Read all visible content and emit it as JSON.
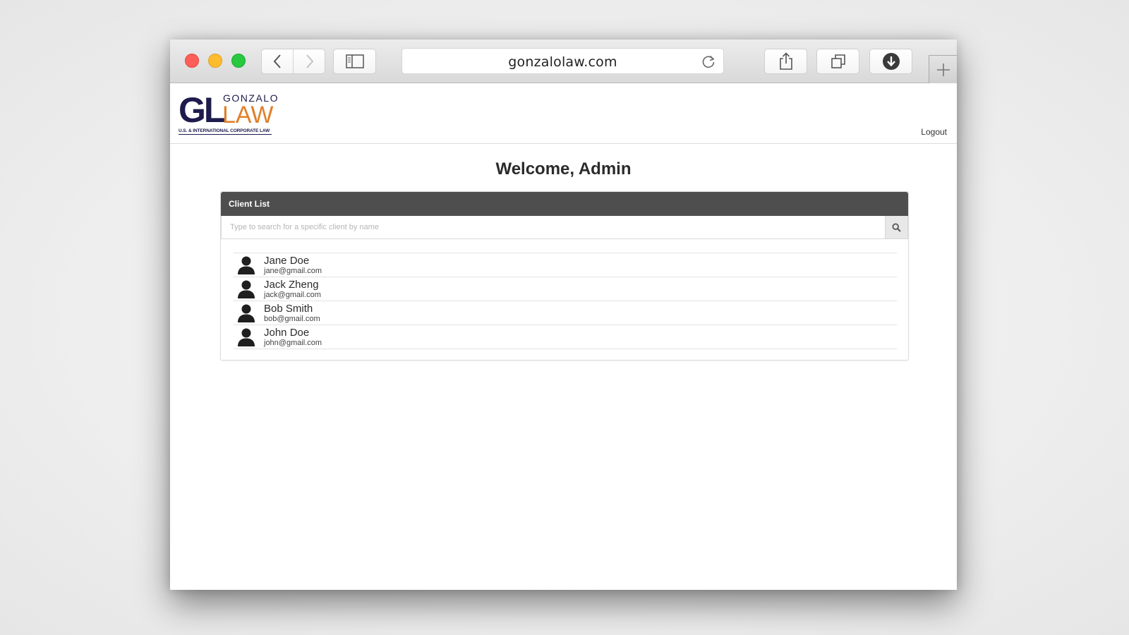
{
  "browser": {
    "url": "gonzalolaw.com",
    "icons": {
      "back": "chevron-left-icon",
      "forward": "chevron-right-icon",
      "sidebar": "sidebar-icon",
      "reload": "reload-icon",
      "share": "share-icon",
      "tabs": "tabs-icon",
      "download": "download-icon",
      "new_tab": "plus-icon"
    }
  },
  "site": {
    "logo": {
      "initials": "GL",
      "top_word": "GONZALO",
      "bottom_word": "LAW",
      "tagline": "U.S. & INTERNATIONAL CORPORATE LAW"
    },
    "logout_label": "Logout"
  },
  "main": {
    "welcome": "Welcome, Admin",
    "panel_title": "Client List",
    "search_placeholder": "Type to search for a specific client by name",
    "clients": [
      {
        "name": "Jane Doe",
        "email": "jane@gmail.com"
      },
      {
        "name": "Jack Zheng",
        "email": "jack@gmail.com"
      },
      {
        "name": "Bob Smith",
        "email": "bob@gmail.com"
      },
      {
        "name": "John Doe",
        "email": "john@gmail.com"
      }
    ]
  },
  "colors": {
    "brand_navy": "#1e1b4d",
    "brand_orange": "#e0802a",
    "panel_header": "#4e4e4e"
  }
}
